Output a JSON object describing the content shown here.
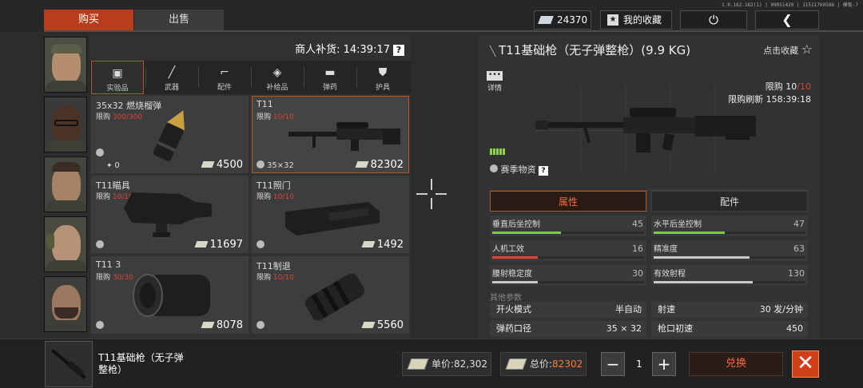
{
  "version": "1.0.162.162(1) | 09051420 | 11511760586 | 模板-7",
  "tabs": {
    "buy": "购买",
    "sell": "出售"
  },
  "top": {
    "currency": "24370",
    "favorites": "我的收藏"
  },
  "shop": {
    "restock_label": "商人补货: 14:39:17",
    "help": "?",
    "categories": [
      {
        "label": "实验品",
        "icon": "briefcase-icon"
      },
      {
        "label": "武器",
        "icon": "rifle-icon"
      },
      {
        "label": "配件",
        "icon": "pistol-icon"
      },
      {
        "label": "补给品",
        "icon": "box-icon"
      },
      {
        "label": "弹药",
        "icon": "bullet-icon"
      },
      {
        "label": "护具",
        "icon": "vest-icon"
      }
    ],
    "items": [
      {
        "name": "35x32 燃烧榴弹",
        "limit_prefix": "限购 ",
        "limit": "300/300",
        "sub": "0",
        "price": "4500"
      },
      {
        "name": "T11",
        "limit_prefix": "限购 ",
        "limit": "10/10",
        "sub": "35×32",
        "price": "82302"
      },
      {
        "name": "T11瞄具",
        "limit_prefix": "限购 ",
        "limit": "10/10",
        "sub": "",
        "price": "11697"
      },
      {
        "name": "T11照门",
        "limit_prefix": "限购 ",
        "limit": "10/10",
        "sub": "",
        "price": "1492"
      },
      {
        "name": "T11 3",
        "limit_prefix": "限购 ",
        "limit": "30/30",
        "sub": "",
        "price": "8078"
      },
      {
        "name": "T11制退",
        "limit_prefix": "限购 ",
        "limit": "10/10",
        "sub": "",
        "price": "5560"
      }
    ]
  },
  "detail": {
    "title": "T11基础枪（无子弹整枪）(9.9 KG)",
    "click_fav": "点击收藏",
    "details_label": "详情",
    "limit_prefix": "限购 ",
    "limit_a": "10",
    "limit_b": "/10",
    "refresh": "限购刷新 158:39:18",
    "season": "赛季物资",
    "tab_attr": "属性",
    "tab_parts": "配件",
    "stats": [
      {
        "label": "垂直后坐控制",
        "value": "45",
        "fraction": 0.45,
        "color": "#7ccf3a"
      },
      {
        "label": "水平后坐控制",
        "value": "47",
        "fraction": 0.47,
        "color": "#7ccf3a"
      },
      {
        "label": "人机工效",
        "value": "16",
        "fraction": 0.3,
        "color": "#e0442e"
      },
      {
        "label": "精准度",
        "value": "63",
        "fraction": 0.63,
        "color": "#c8c8c8"
      },
      {
        "label": "腰射稳定度",
        "value": "30",
        "fraction": 0.3,
        "color": "#c8c8c8"
      },
      {
        "label": "有效射程",
        "value": "130",
        "fraction": 0.65,
        "color": "#c8c8c8"
      }
    ],
    "other_label": "其他参数",
    "params": [
      {
        "label": "开火模式",
        "value": "半自动"
      },
      {
        "label": "射速",
        "value": "30 发/分钟"
      },
      {
        "label": "弹药口径",
        "value": "35 × 32"
      },
      {
        "label": "枪口初速",
        "value": "450"
      }
    ]
  },
  "bottom": {
    "name": "T11基础枪（无子弹整枪）",
    "unit_label": "单价:82,302",
    "total_prefix": "总价:",
    "total_value": "82302",
    "qty": "1",
    "minus": "−",
    "plus": "+",
    "exchange": "兑换",
    "close": "✕"
  },
  "colors": {
    "accent": "#b83d1d",
    "limit_red": "#e0442e",
    "total_orange": "#ff7a30"
  }
}
